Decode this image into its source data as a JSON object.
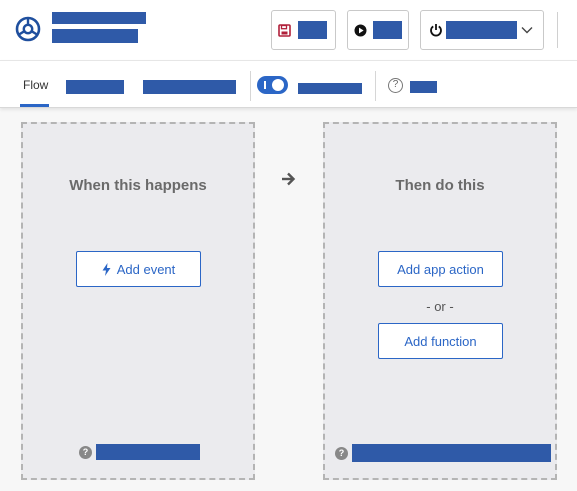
{
  "colors": {
    "accent": "#2b66c6",
    "redaction": "#2f5aa8",
    "panel_border": "#b4b4b4"
  },
  "icons": {
    "logo": "circle-triad-logo-icon",
    "save": "floppy-disk-icon",
    "run": "play-circle-icon",
    "power": "power-icon",
    "dropdown": "chevron-down-icon",
    "arrow": "arrow-right-icon",
    "event": "lightning-bolt-icon",
    "help": "question-circle-icon"
  },
  "tabs": {
    "flow_label": "Flow"
  },
  "trigger_panel": {
    "heading": "When this happens",
    "add_event_label": "Add event"
  },
  "action_panel": {
    "heading": "Then do this",
    "add_app_action_label": "Add app action",
    "or_label": "- or -",
    "add_function_label": "Add function"
  },
  "help": {
    "question_glyph": "?"
  }
}
